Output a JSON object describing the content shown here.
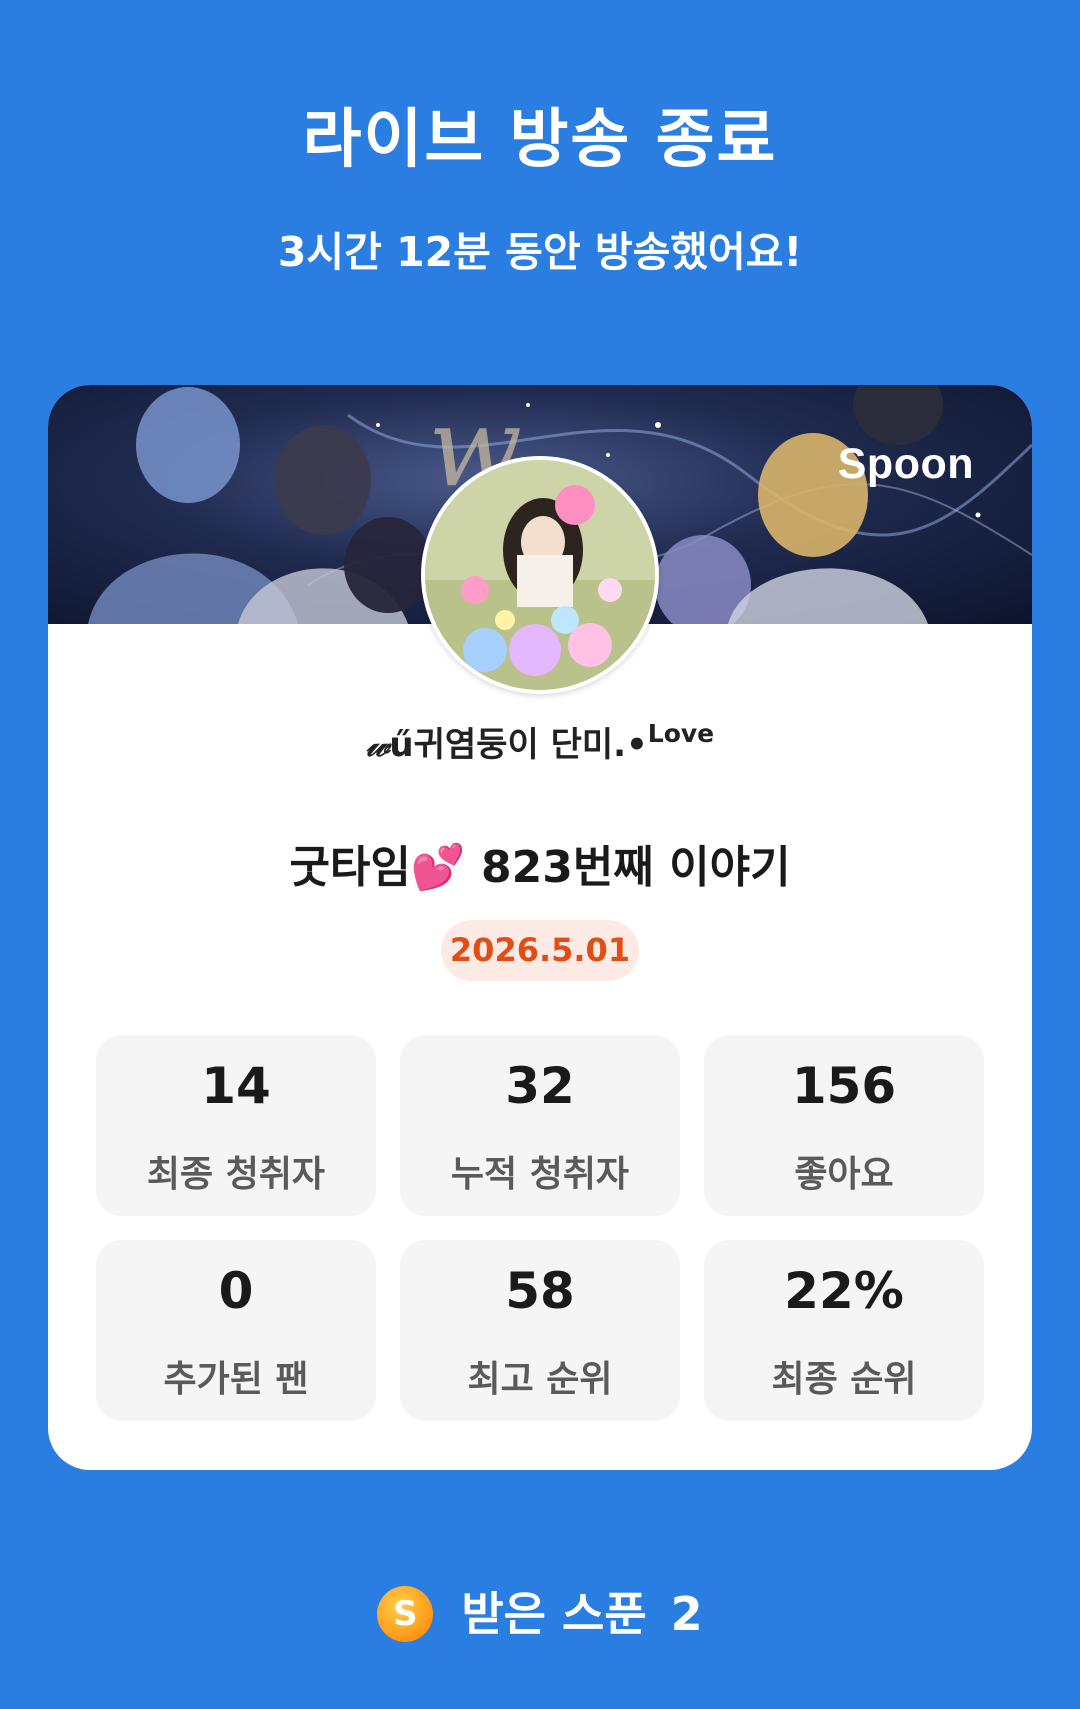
{
  "header": {
    "title": "라이브 방송 종료",
    "subtitle": "3시간 12분 동안 방송했어요!"
  },
  "card": {
    "brand": "Spoon",
    "host": {
      "prefix": "𝓌",
      "name": "ű귀염둥이 단미.•",
      "suffix": "Love"
    },
    "broadcast_title": "굿타임💕 823번째 이야기",
    "date": "2026.5.01",
    "stats": [
      {
        "value": "14",
        "label": "최종 청취자"
      },
      {
        "value": "32",
        "label": "누적 청취자"
      },
      {
        "value": "156",
        "label": "좋아요"
      },
      {
        "value": "0",
        "label": "추가된 팬"
      },
      {
        "value": "58",
        "label": "최고 순위"
      },
      {
        "value": "22%",
        "label": "최종 순위"
      }
    ]
  },
  "footer": {
    "spoon_icon_letter": "S",
    "spoon_label": "받은 스푼",
    "spoon_count": "2"
  },
  "colors": {
    "background": "#2a7de1",
    "date_text": "#e14d14",
    "date_badge": "#fdeae4",
    "tile": "#f5f5f6"
  }
}
